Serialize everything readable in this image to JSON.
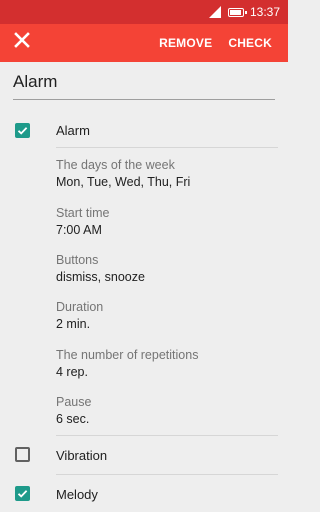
{
  "status_bar": {
    "time": "13:37"
  },
  "app_bar": {
    "remove_label": "REMOVE",
    "check_label": "CHECK"
  },
  "title": {
    "value": "Alarm"
  },
  "alarm": {
    "label": "Alarm",
    "checked": true
  },
  "settings": [
    {
      "label": "The days of the week",
      "value": "Mon, Tue, Wed, Thu, Fri"
    },
    {
      "label": "Start time",
      "value": "7:00 AM"
    },
    {
      "label": "Buttons",
      "value": "dismiss, snooze"
    },
    {
      "label": "Duration",
      "value": "2 min."
    },
    {
      "label": "The number of repetitions",
      "value": "4 rep."
    },
    {
      "label": "Pause",
      "value": "6 sec."
    }
  ],
  "vibration": {
    "label": "Vibration",
    "checked": false
  },
  "melody": {
    "label": "Melody",
    "checked": true
  },
  "colors": {
    "status_bar": "#d32f2f",
    "app_bar": "#f44336",
    "checkbox_accent": "#1e9a8a"
  }
}
